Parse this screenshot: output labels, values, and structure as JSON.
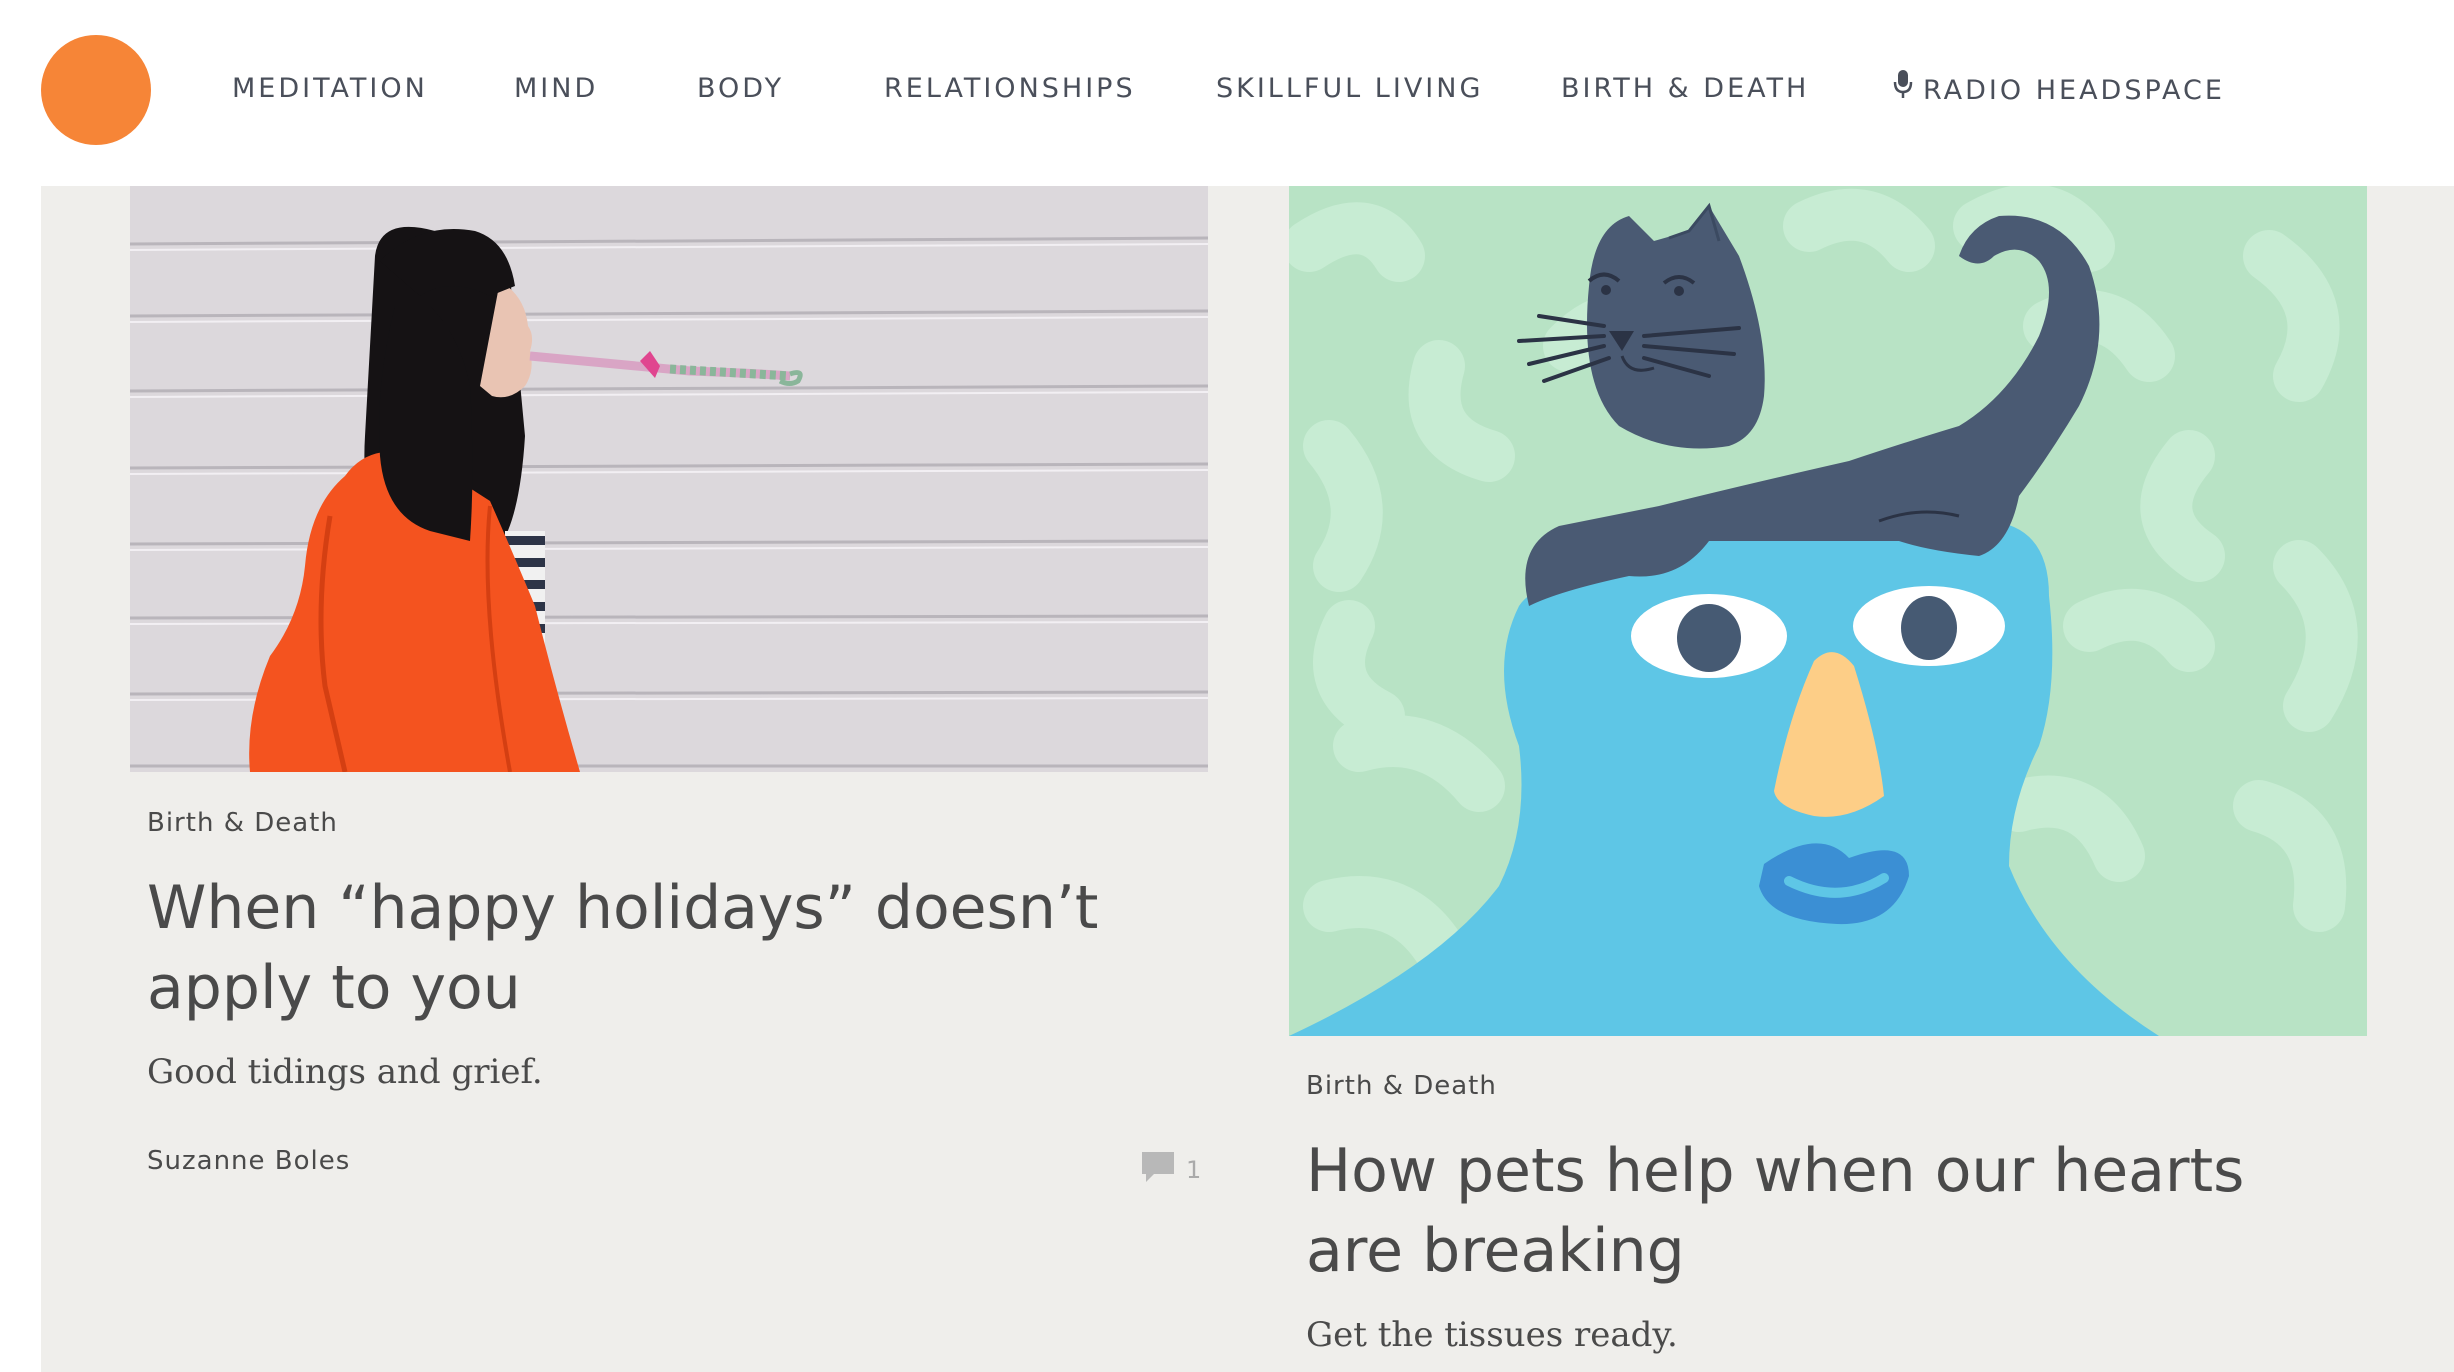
{
  "nav": {
    "items": [
      {
        "label": "MEDITATION"
      },
      {
        "label": "MIND"
      },
      {
        "label": "BODY"
      },
      {
        "label": "RELATIONSHIPS"
      },
      {
        "label": "SKILLFUL LIVING"
      },
      {
        "label": "BIRTH & DEATH"
      },
      {
        "label": "RADIO HEADSPACE",
        "icon": "microphone-icon"
      }
    ]
  },
  "colors": {
    "brand_orange": "#f68537",
    "content_bg": "#efeeeb",
    "text": "#4a4a4a"
  },
  "articles": [
    {
      "category": "Birth & Death",
      "title": "When “happy holidays” doesn’t apply to you",
      "subtitle": "Good tidings and grief.",
      "author": "Suzanne Boles",
      "comment_count": "1"
    },
    {
      "category": "Birth & Death",
      "title": "How pets help when our hearts are breaking",
      "subtitle": "Get the tissues ready."
    }
  ]
}
